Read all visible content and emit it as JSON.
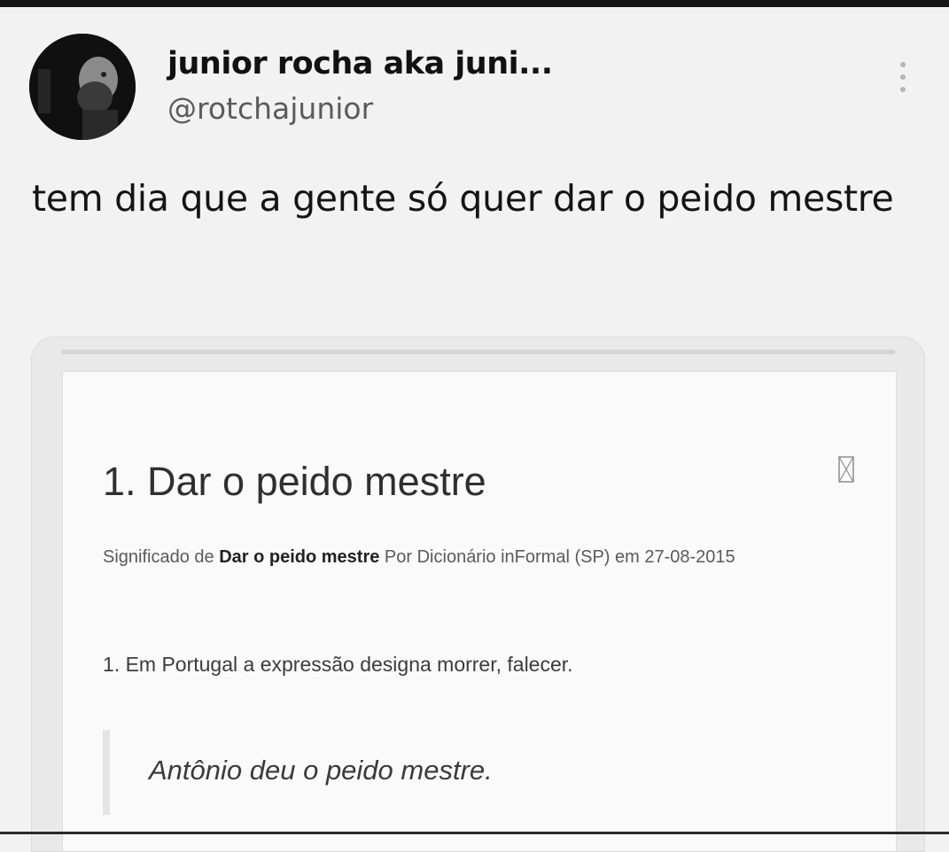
{
  "tweet": {
    "display_name": "junior rocha aka juni...",
    "handle": "@rotchajunior",
    "text": "tem dia que a gente só quer dar o peido mestre",
    "avatar_icon": "profile-photo",
    "menu_icon": "more-vertical-icon"
  },
  "media": {
    "title": "1. Dar o peido mestre",
    "meta_prefix": "Significado de ",
    "meta_term": "Dar o peido mestre",
    "meta_suffix": " Por Dicionário inFormal (SP) em 27-08-2015",
    "definition": "1. Em Portugal a expressão designa morrer, falecer.",
    "example": "Antônio deu o peido mestre.",
    "broken_image_icon": "broken-image-icon"
  },
  "colors": {
    "background": "#f2f2f2",
    "card": "#fafafa",
    "handle": "#5b5b5b"
  }
}
